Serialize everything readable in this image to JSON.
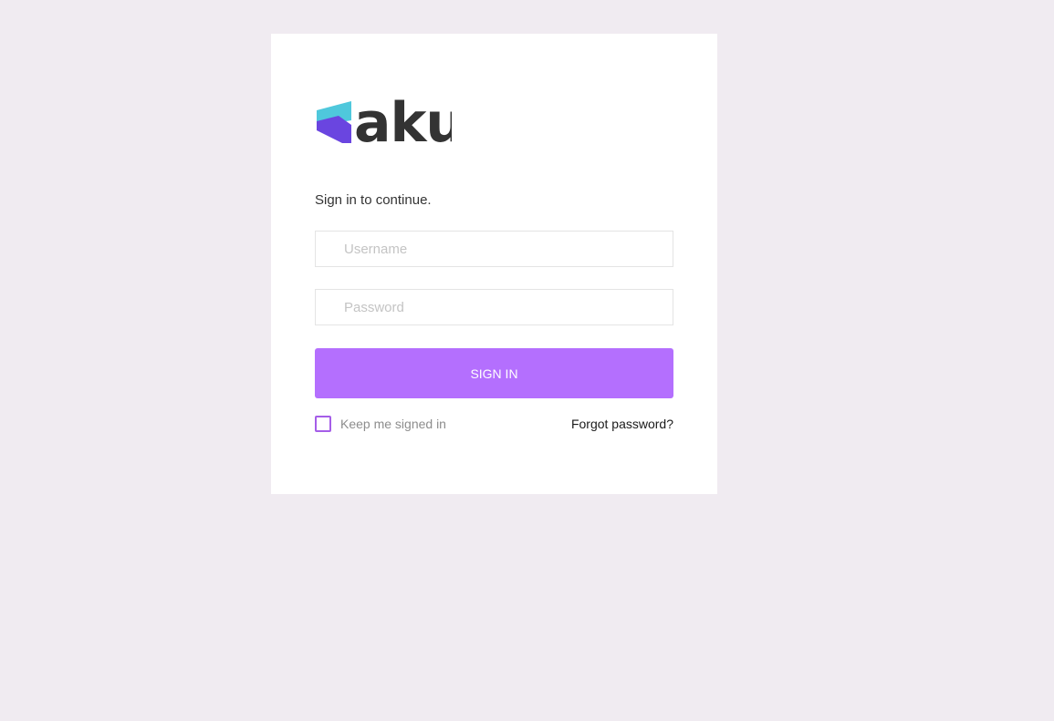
{
  "brand": {
    "name": "aku",
    "colors": {
      "logo_teal": "#4fc8dc",
      "logo_purple": "#6a45e0",
      "logo_text": "#333333",
      "accent": "#b46ffe",
      "background": "#f0ebf1"
    }
  },
  "login": {
    "subtitle": "Sign in to continue.",
    "username_placeholder": "Username",
    "password_placeholder": "Password",
    "signin_label": "SIGN IN",
    "keep_signed_in_label": "Keep me signed in",
    "keep_signed_in_checked": false,
    "forgot_password_label": "Forgot password?"
  }
}
